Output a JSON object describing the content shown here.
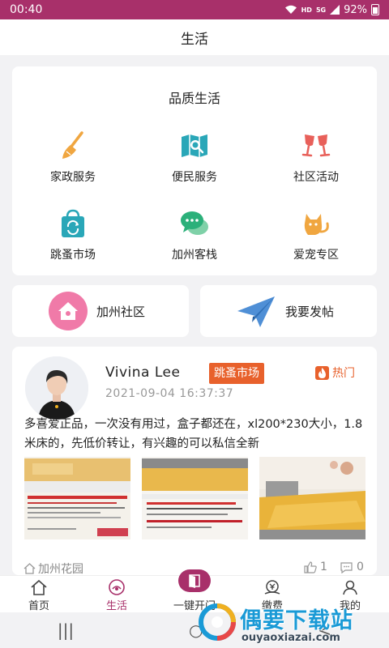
{
  "status_bar": {
    "time": "00:40",
    "hd": "HD",
    "net": "5G",
    "battery": "92%"
  },
  "nav": {
    "title": "生活"
  },
  "quality": {
    "title": "品质生活",
    "items": [
      {
        "label": "家政服务",
        "icon": "broom-icon"
      },
      {
        "label": "便民服务",
        "icon": "map-icon"
      },
      {
        "label": "社区活动",
        "icon": "wine-glasses-icon"
      },
      {
        "label": "跳蚤市场",
        "icon": "shopping-bag-icon"
      },
      {
        "label": "加州客栈",
        "icon": "chat-bubbles-icon"
      },
      {
        "label": "爱宠专区",
        "icon": "cat-icon"
      }
    ]
  },
  "actions": {
    "community": {
      "label": "加州社区",
      "icon": "house-icon"
    },
    "post": {
      "label": "我要发帖",
      "icon": "paper-plane-icon"
    }
  },
  "post": {
    "author": "Vivina Lee",
    "tag": "跳蚤市场",
    "hot_label": "热门",
    "timestamp": "2021-09-04 16:37:37",
    "text": "多喜爱正品，一次没有用过，盒子都还在，xl200*230大小，1.8米床的，先低价转让，有兴趣的可以私信全新",
    "location": "加州花园",
    "likes": "1",
    "comments": "0"
  },
  "tabs": [
    {
      "label": "首页",
      "icon": "home-icon"
    },
    {
      "label": "生活",
      "icon": "life-icon",
      "active": true
    },
    {
      "label": "一键开门",
      "icon": "door-icon"
    },
    {
      "label": "缴费",
      "icon": "payment-icon"
    },
    {
      "label": "我的",
      "icon": "profile-icon"
    }
  ],
  "watermark": {
    "text": "偶要下载站",
    "url": "ouyaoxiazai.com"
  },
  "colors": {
    "brand": "#a8306a",
    "accent": "#e8612c",
    "icon_orange": "#f0a640",
    "icon_teal": "#2aa7b8",
    "icon_red": "#e8605a"
  }
}
